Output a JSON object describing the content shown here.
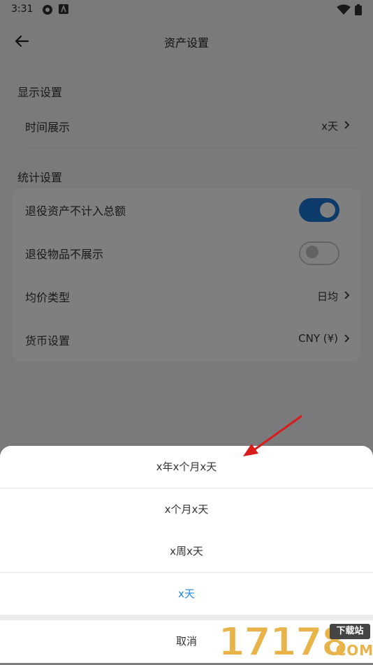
{
  "statusbar": {
    "time": "3:31"
  },
  "appbar": {
    "title": "资产设置"
  },
  "display_section": {
    "title": "显示设置",
    "rows": [
      {
        "label": "时间展示",
        "value": "x天"
      }
    ]
  },
  "stats_section": {
    "title": "统计设置",
    "rows": [
      {
        "label": "退役资产不计入总额",
        "toggle": "on"
      },
      {
        "label": "退役物品不展示",
        "toggle": "off"
      },
      {
        "label": "均价类型",
        "value": "日均"
      },
      {
        "label": "货币设置",
        "value": "CNY (¥)"
      }
    ]
  },
  "sheet": {
    "options": [
      "x年x个月x天",
      "x个月x天",
      "x周x天",
      "x天"
    ],
    "selected_index": 3,
    "cancel_label": "取消"
  },
  "watermark": {
    "digits": "17178",
    "badge": "下载站",
    "suffix": ".COM"
  },
  "colors": {
    "accent": "#1976d2",
    "selected_text": "#1e88e5",
    "arrow": "#d81b1b"
  }
}
